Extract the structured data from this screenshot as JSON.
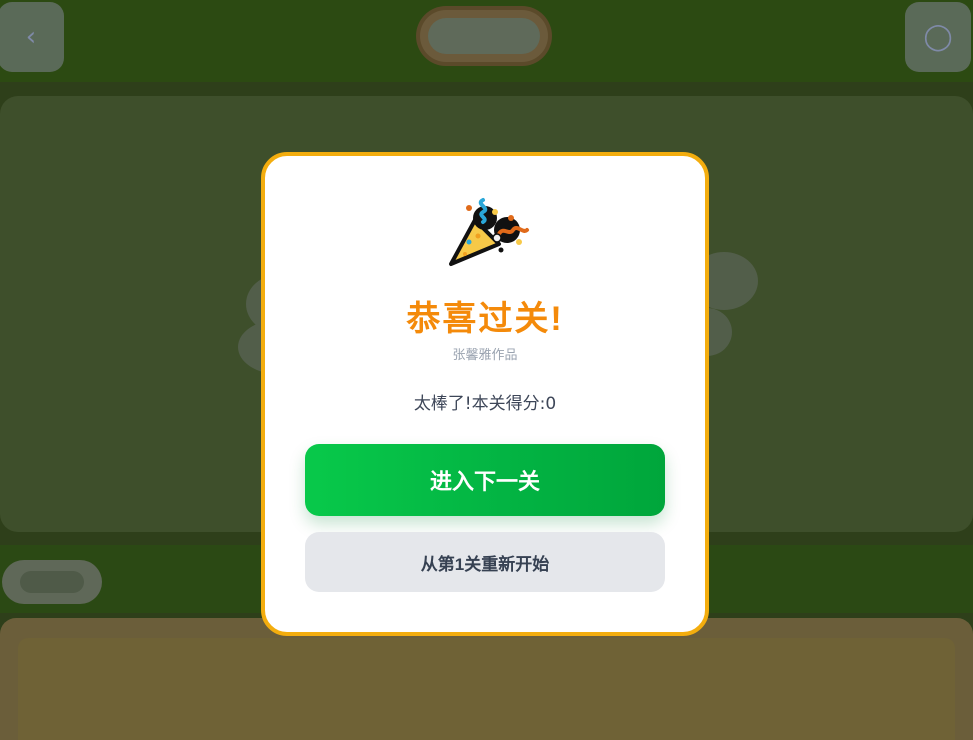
{
  "background": {
    "top_left_icon": "left-arrow-icon",
    "top_right_icon": "thermometer-icon"
  },
  "modal": {
    "icon": "party-popper-icon",
    "title": "恭喜过关!",
    "author": "张馨雅作品",
    "score_text": "太棒了!本关得分:0",
    "next_button": "进入下一关",
    "restart_button": "从第1关重新开始"
  },
  "colors": {
    "title": "#f48a0a",
    "modal_border": "#f3ad0e",
    "next_button": "#03b443",
    "restart_button": "#e5e7eb"
  }
}
